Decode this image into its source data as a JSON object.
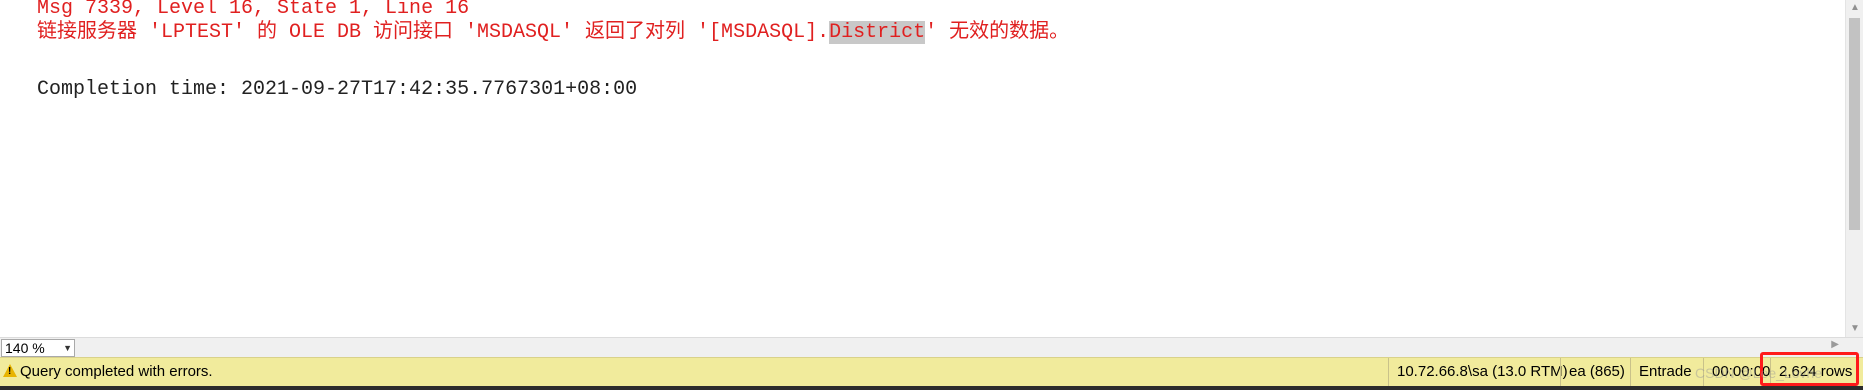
{
  "messages": {
    "line1": "Msg 7339, Level 16, State 1, Line 16",
    "line2_before": "链接服务器 'LPTEST' 的 OLE DB 访问接口 'MSDASQL' 返回了对列 '[MSDASQL].",
    "line2_highlight": "District",
    "line2_after": "' 无效的数据。",
    "completion": "Completion time: 2021-09-27T17:42:35.7767301+08:00"
  },
  "zoom": {
    "value": "140 %"
  },
  "status": {
    "message": "Query completed with errors.",
    "server": "10.72.66.8\\sa (13.0 RTM)",
    "user": "ea (865)",
    "database": "Entrade",
    "time": "00:00:00",
    "rows": "2,624 rows"
  },
  "watermark": "CSDN @Lee_Lovhe",
  "colors": {
    "error_text": "#e02020",
    "status_bar": "#f1eb9c",
    "highlight_box": "#ff1a1a"
  }
}
